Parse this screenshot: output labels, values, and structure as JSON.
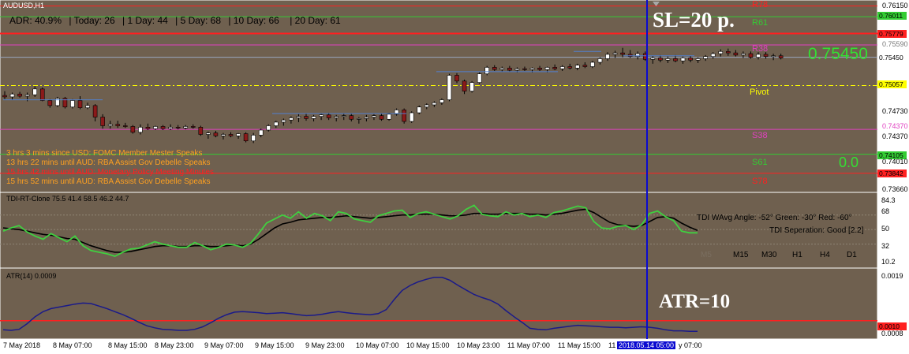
{
  "window": {
    "title": "AUDUSD,H1"
  },
  "adr": {
    "adr": "ADR: 40.9%",
    "today": "| Today: 26",
    "d1": "| 1 Day: 44",
    "d5": "| 5 Day: 68",
    "d10": "| 10 Day: 66",
    "d20": "| 20 Day: 61"
  },
  "annotations": {
    "sl": "SL=20 p.",
    "atr": "ATR=10",
    "price_big": "0.75450",
    "zero": "0.0"
  },
  "levels": {
    "r78": "R78",
    "r61": "R61",
    "r38": "R38",
    "pivot": "Pivot",
    "s38": "S38",
    "s61": "S61",
    "s78": "S78",
    "colors": {
      "r78": "#ff2020",
      "r61": "#33cc33",
      "r38": "#e040c0",
      "pivot": "#ffff00",
      "s38": "#e040c0",
      "s61": "#33cc33",
      "s78": "#ff2020"
    }
  },
  "price_axis": {
    "ticks": [
      "0.76150",
      "0.75590",
      "0.75450",
      "0.74730",
      "0.74370",
      "0.74010",
      "0.73660"
    ],
    "labels": {
      "p76011": "0.76011",
      "p75779": "0.75779",
      "p75057": "0.75057",
      "p74105": "0.74105",
      "p73842": "0.73842"
    }
  },
  "news": [
    {
      "text": "3 hrs 3 mins since USD: FOMC Member Mester Speaks",
      "color": "#ffa020"
    },
    {
      "text": "13 hrs 22 mins until AUD: RBA Assist Gov Debelle Speaks",
      "color": "#ffa020"
    },
    {
      "text": "15 hrs 42 mins until AUD: Monetary Policy Meeting Minutes",
      "color": "#ff2020"
    },
    {
      "text": "15 hrs 52 mins until AUD: RBA Assist Gov Debelle Speaks",
      "color": "#ffa020"
    }
  ],
  "tdi": {
    "title": "TDI-RT-Clone 75.5 41.4 58.5 46.2 44.7",
    "angle": "TDI WAvg Angle: -52°  Green: -30°  Red: -60°",
    "separation": "TDI Seperation: Good [2.2]",
    "timeframes": [
      "M5",
      "M15",
      "M30",
      "H1",
      "H4",
      "D1"
    ],
    "axis": [
      "84.3",
      "68",
      "50",
      "32",
      "10.2"
    ]
  },
  "atr_panel": {
    "title": "ATR(14) 0.0009",
    "axis": [
      "0.0019",
      "0.0010",
      "0.0008"
    ]
  },
  "time_axis": {
    "labels": [
      "7 May 2018",
      "8 May 07:00",
      "8 May 15:00",
      "8 May 23:00",
      "9 May 07:00",
      "9 May 15:00",
      "9 May 23:00",
      "10 May 07:00",
      "10 May 15:00",
      "10 May 23:00",
      "11 May 07:00",
      "11 May 15:00",
      "11 ",
      "y 07:00"
    ],
    "cursor": "2018.05.14 05:00"
  },
  "colors": {
    "background": "#6f604f",
    "bull": "#ffffff",
    "bear": "#8b1a1a",
    "tdi_green": "#40d040",
    "tdi_black": "#000000",
    "atr_line": "#1a1a8a",
    "crosshair": "#0a0ad0"
  },
  "chart_data": {
    "type": "candlestick",
    "title": "AUDUSD,H1",
    "candles": [
      {
        "o": 0.7492,
        "h": 0.7498,
        "l": 0.7487,
        "c": 0.749
      },
      {
        "o": 0.749,
        "h": 0.7496,
        "l": 0.7486,
        "c": 0.7494
      },
      {
        "o": 0.7494,
        "h": 0.7497,
        "l": 0.7489,
        "c": 0.7491
      },
      {
        "o": 0.7491,
        "h": 0.7496,
        "l": 0.7484,
        "c": 0.7493
      },
      {
        "o": 0.7493,
        "h": 0.7505,
        "l": 0.749,
        "c": 0.7501
      },
      {
        "o": 0.7501,
        "h": 0.7503,
        "l": 0.7484,
        "c": 0.7485
      },
      {
        "o": 0.7485,
        "h": 0.7487,
        "l": 0.7475,
        "c": 0.7478
      },
      {
        "o": 0.7478,
        "h": 0.749,
        "l": 0.7476,
        "c": 0.7488
      },
      {
        "o": 0.7488,
        "h": 0.749,
        "l": 0.7474,
        "c": 0.7476
      },
      {
        "o": 0.7476,
        "h": 0.7487,
        "l": 0.7474,
        "c": 0.7485
      },
      {
        "o": 0.7485,
        "h": 0.7491,
        "l": 0.7473,
        "c": 0.7475
      },
      {
        "o": 0.7475,
        "h": 0.7482,
        "l": 0.7473,
        "c": 0.7478
      },
      {
        "o": 0.7478,
        "h": 0.748,
        "l": 0.7456,
        "c": 0.7462
      },
      {
        "o": 0.7462,
        "h": 0.7466,
        "l": 0.7446,
        "c": 0.745
      },
      {
        "o": 0.745,
        "h": 0.7457,
        "l": 0.7446,
        "c": 0.7452
      },
      {
        "o": 0.7452,
        "h": 0.7457,
        "l": 0.7447,
        "c": 0.745
      },
      {
        "o": 0.745,
        "h": 0.7454,
        "l": 0.7447,
        "c": 0.7449
      },
      {
        "o": 0.7449,
        "h": 0.7451,
        "l": 0.7439,
        "c": 0.7441
      },
      {
        "o": 0.7441,
        "h": 0.7452,
        "l": 0.7438,
        "c": 0.7448
      },
      {
        "o": 0.7448,
        "h": 0.7453,
        "l": 0.7444,
        "c": 0.7446
      },
      {
        "o": 0.7446,
        "h": 0.745,
        "l": 0.7444,
        "c": 0.7449
      },
      {
        "o": 0.7449,
        "h": 0.7451,
        "l": 0.7444,
        "c": 0.7446
      },
      {
        "o": 0.7446,
        "h": 0.7452,
        "l": 0.7444,
        "c": 0.7448
      },
      {
        "o": 0.7448,
        "h": 0.7451,
        "l": 0.7445,
        "c": 0.7447
      },
      {
        "o": 0.7447,
        "h": 0.7451,
        "l": 0.7445,
        "c": 0.7449
      },
      {
        "o": 0.7449,
        "h": 0.7452,
        "l": 0.7446,
        "c": 0.7448
      },
      {
        "o": 0.7448,
        "h": 0.745,
        "l": 0.7436,
        "c": 0.7438
      },
      {
        "o": 0.7438,
        "h": 0.7442,
        "l": 0.7432,
        "c": 0.744
      },
      {
        "o": 0.744,
        "h": 0.7443,
        "l": 0.7434,
        "c": 0.7436
      },
      {
        "o": 0.7436,
        "h": 0.744,
        "l": 0.7431,
        "c": 0.7438
      },
      {
        "o": 0.7438,
        "h": 0.7441,
        "l": 0.7434,
        "c": 0.7436
      },
      {
        "o": 0.7436,
        "h": 0.744,
        "l": 0.7432,
        "c": 0.7439
      },
      {
        "o": 0.7439,
        "h": 0.7441,
        "l": 0.7427,
        "c": 0.7429
      },
      {
        "o": 0.7429,
        "h": 0.744,
        "l": 0.7426,
        "c": 0.7437
      },
      {
        "o": 0.7437,
        "h": 0.7446,
        "l": 0.7434,
        "c": 0.7444
      },
      {
        "o": 0.7444,
        "h": 0.7452,
        "l": 0.7442,
        "c": 0.745
      },
      {
        "o": 0.745,
        "h": 0.7457,
        "l": 0.7447,
        "c": 0.7455
      },
      {
        "o": 0.7455,
        "h": 0.746,
        "l": 0.745,
        "c": 0.7458
      },
      {
        "o": 0.7458,
        "h": 0.7463,
        "l": 0.7453,
        "c": 0.7461
      },
      {
        "o": 0.7461,
        "h": 0.7466,
        "l": 0.7455,
        "c": 0.7463
      },
      {
        "o": 0.7463,
        "h": 0.7467,
        "l": 0.7457,
        "c": 0.746
      },
      {
        "o": 0.746,
        "h": 0.7465,
        "l": 0.7456,
        "c": 0.7463
      },
      {
        "o": 0.7463,
        "h": 0.7467,
        "l": 0.7458,
        "c": 0.7465
      },
      {
        "o": 0.7465,
        "h": 0.7468,
        "l": 0.7458,
        "c": 0.7461
      },
      {
        "o": 0.7461,
        "h": 0.7465,
        "l": 0.7456,
        "c": 0.7463
      },
      {
        "o": 0.7463,
        "h": 0.7467,
        "l": 0.7458,
        "c": 0.7464
      },
      {
        "o": 0.7464,
        "h": 0.7467,
        "l": 0.7456,
        "c": 0.7459
      },
      {
        "o": 0.7459,
        "h": 0.7462,
        "l": 0.7453,
        "c": 0.746
      },
      {
        "o": 0.746,
        "h": 0.7465,
        "l": 0.7456,
        "c": 0.7462
      },
      {
        "o": 0.7462,
        "h": 0.7466,
        "l": 0.7458,
        "c": 0.7464
      },
      {
        "o": 0.7464,
        "h": 0.7467,
        "l": 0.7457,
        "c": 0.7459
      },
      {
        "o": 0.7459,
        "h": 0.7468,
        "l": 0.7457,
        "c": 0.7466
      },
      {
        "o": 0.7466,
        "h": 0.7474,
        "l": 0.7464,
        "c": 0.7472
      },
      {
        "o": 0.7472,
        "h": 0.7474,
        "l": 0.7453,
        "c": 0.7456
      },
      {
        "o": 0.7456,
        "h": 0.747,
        "l": 0.7454,
        "c": 0.7468
      },
      {
        "o": 0.7468,
        "h": 0.7478,
        "l": 0.7466,
        "c": 0.7476
      },
      {
        "o": 0.7476,
        "h": 0.7481,
        "l": 0.7473,
        "c": 0.7479
      },
      {
        "o": 0.7479,
        "h": 0.7484,
        "l": 0.7476,
        "c": 0.7482
      },
      {
        "o": 0.7482,
        "h": 0.7488,
        "l": 0.7479,
        "c": 0.7486
      },
      {
        "o": 0.7486,
        "h": 0.7522,
        "l": 0.7484,
        "c": 0.752
      },
      {
        "o": 0.752,
        "h": 0.7523,
        "l": 0.7509,
        "c": 0.7512
      },
      {
        "o": 0.7512,
        "h": 0.7514,
        "l": 0.7494,
        "c": 0.7498
      },
      {
        "o": 0.7498,
        "h": 0.7512,
        "l": 0.7496,
        "c": 0.751
      },
      {
        "o": 0.751,
        "h": 0.7524,
        "l": 0.7508,
        "c": 0.7522
      },
      {
        "o": 0.7522,
        "h": 0.7533,
        "l": 0.752,
        "c": 0.7531
      },
      {
        "o": 0.7531,
        "h": 0.7534,
        "l": 0.7526,
        "c": 0.7528
      },
      {
        "o": 0.7528,
        "h": 0.7532,
        "l": 0.7525,
        "c": 0.753
      },
      {
        "o": 0.753,
        "h": 0.7533,
        "l": 0.7525,
        "c": 0.7527
      },
      {
        "o": 0.7527,
        "h": 0.7531,
        "l": 0.7524,
        "c": 0.7529
      },
      {
        "o": 0.7529,
        "h": 0.7532,
        "l": 0.7526,
        "c": 0.7528
      },
      {
        "o": 0.7528,
        "h": 0.7531,
        "l": 0.7524,
        "c": 0.753
      },
      {
        "o": 0.753,
        "h": 0.7533,
        "l": 0.7526,
        "c": 0.7528
      },
      {
        "o": 0.7528,
        "h": 0.7532,
        "l": 0.7524,
        "c": 0.7531
      },
      {
        "o": 0.7531,
        "h": 0.7535,
        "l": 0.7527,
        "c": 0.7529
      },
      {
        "o": 0.7529,
        "h": 0.7534,
        "l": 0.7526,
        "c": 0.7532
      },
      {
        "o": 0.7532,
        "h": 0.7536,
        "l": 0.7528,
        "c": 0.753
      },
      {
        "o": 0.753,
        "h": 0.7536,
        "l": 0.7527,
        "c": 0.7534
      },
      {
        "o": 0.7534,
        "h": 0.7538,
        "l": 0.753,
        "c": 0.7532
      },
      {
        "o": 0.7532,
        "h": 0.754,
        "l": 0.753,
        "c": 0.7538
      },
      {
        "o": 0.7538,
        "h": 0.7545,
        "l": 0.7535,
        "c": 0.7543
      },
      {
        "o": 0.7543,
        "h": 0.7552,
        "l": 0.754,
        "c": 0.7549
      },
      {
        "o": 0.7549,
        "h": 0.7554,
        "l": 0.7544,
        "c": 0.7551
      },
      {
        "o": 0.7551,
        "h": 0.7558,
        "l": 0.7545,
        "c": 0.7549
      },
      {
        "o": 0.7549,
        "h": 0.7555,
        "l": 0.7544,
        "c": 0.7546
      },
      {
        "o": 0.7546,
        "h": 0.7553,
        "l": 0.7542,
        "c": 0.755
      },
      {
        "o": 0.755,
        "h": 0.7553,
        "l": 0.754,
        "c": 0.7542
      },
      {
        "o": 0.7542,
        "h": 0.7547,
        "l": 0.7536,
        "c": 0.7544
      },
      {
        "o": 0.7544,
        "h": 0.7548,
        "l": 0.7538,
        "c": 0.7541
      },
      {
        "o": 0.7541,
        "h": 0.7546,
        "l": 0.7537,
        "c": 0.7543
      },
      {
        "o": 0.7543,
        "h": 0.7548,
        "l": 0.7538,
        "c": 0.754
      },
      {
        "o": 0.754,
        "h": 0.7546,
        "l": 0.7536,
        "c": 0.7544
      },
      {
        "o": 0.7544,
        "h": 0.7547,
        "l": 0.7538,
        "c": 0.7541
      },
      {
        "o": 0.7541,
        "h": 0.7545,
        "l": 0.7537,
        "c": 0.7543
      },
      {
        "o": 0.7543,
        "h": 0.7548,
        "l": 0.754,
        "c": 0.7546
      },
      {
        "o": 0.7546,
        "h": 0.7552,
        "l": 0.7543,
        "c": 0.755
      },
      {
        "o": 0.755,
        "h": 0.7556,
        "l": 0.7546,
        "c": 0.7553
      },
      {
        "o": 0.7553,
        "h": 0.7557,
        "l": 0.7547,
        "c": 0.7551
      },
      {
        "o": 0.7551,
        "h": 0.7555,
        "l": 0.7546,
        "c": 0.7548
      },
      {
        "o": 0.7548,
        "h": 0.7553,
        "l": 0.7544,
        "c": 0.755
      },
      {
        "o": 0.755,
        "h": 0.7553,
        "l": 0.7543,
        "c": 0.7545
      },
      {
        "o": 0.7545,
        "h": 0.7552,
        "l": 0.7542,
        "c": 0.7549
      },
      {
        "o": 0.7549,
        "h": 0.7552,
        "l": 0.7543,
        "c": 0.7546
      },
      {
        "o": 0.7546,
        "h": 0.755,
        "l": 0.7541,
        "c": 0.7547
      },
      {
        "o": 0.7547,
        "h": 0.755,
        "l": 0.7542,
        "c": 0.7544
      }
    ],
    "price_range": [
      0.7362,
      0.762
    ],
    "horizontal_levels": [
      {
        "label": "R78",
        "price": 0.7616
      },
      {
        "label": "R61",
        "price": 0.76011
      },
      {
        "label": "0.75779",
        "price": 0.75779
      },
      {
        "label": "R38",
        "price": 0.7562
      },
      {
        "label": "0.75450",
        "price": 0.7545
      },
      {
        "label": "Pivot",
        "price": 0.75057
      },
      {
        "label": "S38",
        "price": 0.7445
      },
      {
        "label": "S61",
        "price": 0.74105
      },
      {
        "label": "S78",
        "price": 0.73842
      }
    ],
    "tdi_range": [
      10.2,
      84.3
    ],
    "tdi_green": [
      48,
      52,
      55,
      47,
      42,
      38,
      45,
      40,
      35,
      42,
      30,
      24,
      22,
      20,
      17,
      22,
      26,
      27,
      31,
      35,
      32,
      30,
      28,
      28,
      34,
      30,
      25,
      28,
      32,
      31,
      28,
      33,
      45,
      58,
      63,
      68,
      64,
      72,
      64,
      70,
      67,
      61,
      72,
      70,
      63,
      61,
      59,
      67,
      70,
      73,
      74,
      65,
      70,
      72,
      69,
      66,
      63,
      67,
      75,
      80,
      69,
      67,
      66,
      72,
      68,
      70,
      66,
      68,
      65,
      71,
      73,
      76,
      79,
      77,
      60,
      52,
      51,
      54,
      55,
      50,
      56,
      70,
      73,
      66,
      61,
      48,
      46,
      46
    ],
    "tdi_black": [
      52,
      51,
      50,
      48,
      46,
      44,
      43,
      41,
      39,
      38,
      34,
      30,
      27,
      24,
      22,
      22,
      23,
      25,
      27,
      29,
      30,
      30,
      29,
      29,
      30,
      30,
      29,
      29,
      30,
      31,
      30,
      32,
      38,
      45,
      52,
      57,
      59,
      62,
      63,
      64,
      65,
      65,
      66,
      67,
      66,
      65,
      64,
      65,
      66,
      67,
      68,
      68,
      69,
      69,
      69,
      68,
      67,
      67,
      68,
      70,
      70,
      69,
      69,
      70,
      70,
      70,
      69,
      69,
      68,
      69,
      70,
      72,
      74,
      75,
      71,
      65,
      59,
      56,
      55,
      54,
      55,
      60,
      65,
      66,
      64,
      58,
      53,
      49
    ],
    "atr_range": [
      0.0007,
      0.00195
    ],
    "atr": [
      0.00082,
      0.00081,
      0.00083,
      0.00094,
      0.00108,
      0.00118,
      0.00124,
      0.00127,
      0.0013,
      0.00133,
      0.00135,
      0.00134,
      0.00129,
      0.00124,
      0.00118,
      0.00112,
      0.00105,
      0.00097,
      0.0009,
      0.00086,
      0.00083,
      0.00082,
      0.00081,
      0.00081,
      0.00083,
      0.00088,
      0.00096,
      0.00105,
      0.00112,
      0.00117,
      0.00118,
      0.00117,
      0.00116,
      0.00114,
      0.00115,
      0.00116,
      0.00114,
      0.00112,
      0.0011,
      0.00111,
      0.00113,
      0.00116,
      0.00118,
      0.00116,
      0.00114,
      0.00113,
      0.00112,
      0.00114,
      0.00122,
      0.00142,
      0.0016,
      0.0017,
      0.00177,
      0.00182,
      0.00186,
      0.00186,
      0.0018,
      0.0017,
      0.00161,
      0.00152,
      0.00146,
      0.00141,
      0.00133,
      0.0012,
      0.00108,
      0.00097,
      0.00085,
      0.00083,
      0.00082,
      0.00085,
      0.00087,
      0.00089,
      0.00091,
      0.0009,
      0.00089,
      0.00088,
      0.00087,
      0.00087,
      0.00086,
      0.00087,
      0.00088,
      0.00087,
      0.00085,
      0.00082,
      0.0008,
      0.0008,
      0.00079,
      0.00079
    ],
    "atr_level": 0.001
  }
}
